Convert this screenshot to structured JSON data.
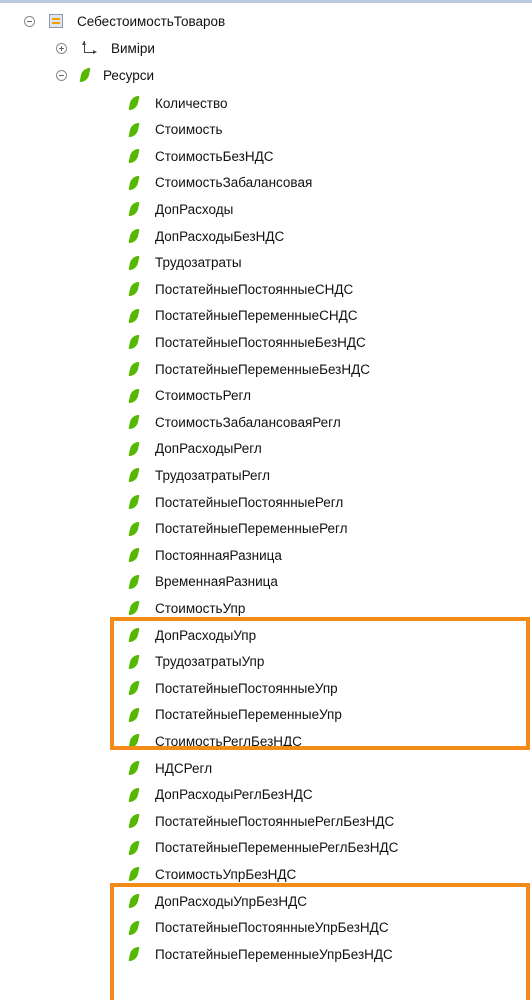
{
  "tree": {
    "root": "СебестоимостьТоваров",
    "dimensions": "Виміри",
    "resources": "Ресурси",
    "items": [
      "Количество",
      "Стоимость",
      "СтоимостьБезНДС",
      "СтоимостьЗабалансовая",
      "ДопРасходы",
      "ДопРасходыБезНДС",
      "Трудозатраты",
      "ПостатейныеПостоянныеСНДС",
      "ПостатейныеПеременныеСНДС",
      "ПостатейныеПостоянныеБезНДС",
      "ПостатейныеПеременныеБезНДС",
      "СтоимостьРегл",
      "СтоимостьЗабалансоваяРегл",
      "ДопРасходыРегл",
      "ТрудозатратыРегл",
      "ПостатейныеПостоянныеРегл",
      "ПостатейныеПеременныеРегл",
      "ПостояннаяРазница",
      "ВременнаяРазница",
      "СтоимостьУпр",
      "ДопРасходыУпр",
      "ТрудозатратыУпр",
      "ПостатейныеПостоянныеУпр",
      "ПостатейныеПеременныеУпр",
      "СтоимостьРеглБезНДС",
      "НДСРегл",
      "ДопРасходыРеглБезНДС",
      "ПостатейныеПостоянныеРеглБезНДС",
      "ПостатейныеПеременныеРеглБезНДС",
      "СтоимостьУпрБезНДС",
      "ДопРасходыУпрБезНДС",
      "ПостатейныеПостоянныеУпрБезНДС",
      "ПостатейныеПеременныеУпрБезНДС"
    ]
  },
  "icons": {
    "collapse": "minus-circle-icon",
    "expand": "plus-circle-icon",
    "register": "accumulation-register-icon",
    "dimensions": "dimensions-axis-icon",
    "resource": "resource-leaf-icon"
  },
  "colors": {
    "highlight": "#f28c16",
    "leaf": "#55b800",
    "register_icon": "#f0a000"
  }
}
